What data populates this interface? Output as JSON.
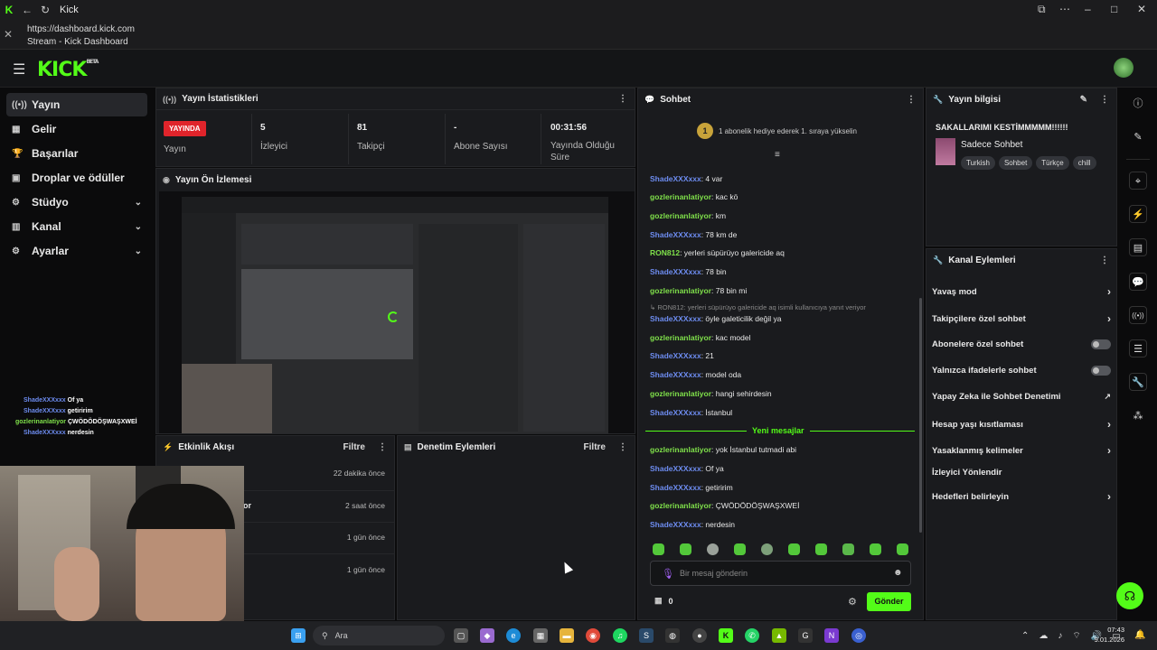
{
  "browser": {
    "tab_title": "Kick",
    "url": "https://dashboard.kick.com",
    "page_title": "Stream - Kick Dashboard"
  },
  "app": {
    "logo": "KICK",
    "logo_sup": "BETA"
  },
  "sidebar": {
    "items": [
      {
        "label": "Yayın",
        "icon": "broadcast-icon"
      },
      {
        "label": "Gelir",
        "icon": "grid-icon"
      },
      {
        "label": "Başarılar",
        "icon": "trophy-icon"
      },
      {
        "label": "Droplar ve ödüller",
        "icon": "gift-icon"
      },
      {
        "label": "Stüdyo",
        "icon": "studio-icon"
      },
      {
        "label": "Kanal",
        "icon": "bar-chart-icon"
      },
      {
        "label": "Ayarlar",
        "icon": "gear-icon"
      }
    ]
  },
  "stats": {
    "title": "Yayın İstatistikleri",
    "live_badge": "YAYINDA",
    "live_label": "Yayın",
    "viewers_value": "5",
    "viewers_label": "İzleyici",
    "followers_value": "81",
    "followers_label": "Takipçi",
    "subs_value": "-",
    "subs_label": "Abone Sayısı",
    "duration_value": "00:31:56",
    "duration_label": "Yayında Olduğu Süre"
  },
  "preview": {
    "title": "Yayın Ön İzlemesi"
  },
  "activity": {
    "title": "Etkinlik Akışı",
    "filter": "Filtre",
    "rows": [
      {
        "text": "",
        "time": "22 dakika önce"
      },
      {
        "text": "or",
        "time": "2 saat önce"
      },
      {
        "text": "",
        "time": "1 gün önce"
      },
      {
        "text": "",
        "time": "1 gün önce"
      }
    ]
  },
  "moderation": {
    "title": "Denetim Eylemleri",
    "filter": "Filtre"
  },
  "chat": {
    "title": "Sohbet",
    "pinned_badge": "1",
    "pinned_text": "1 abonelik hediye ederek 1. sıraya yükselin",
    "messages": [
      {
        "user": "ShadeXXXxxx",
        "color": "b",
        "text": ": 4 var"
      },
      {
        "user": "gozlerinanlatiyor",
        "color": "g",
        "text": ": kac kö"
      },
      {
        "user": "gozlerinanlatiyor",
        "color": "g",
        "text": ": km"
      },
      {
        "user": "ShadeXXXxxx",
        "color": "b",
        "text": ": 78 km de"
      },
      {
        "user": "RON812",
        "color": "g",
        "text": ": yerleri süpürüyo galericide aq"
      },
      {
        "user": "ShadeXXXxxx",
        "color": "b",
        "text": ": 78 bin"
      },
      {
        "user": "gozlerinanlatiyor",
        "color": "g",
        "text": ": 78 bin mi"
      },
      {
        "user": "ShadeXXXxxx",
        "color": "b",
        "text": ": öyle galeticilik değil ya"
      },
      {
        "user": "gozlerinanlatiyor",
        "color": "g",
        "text": ": kac model"
      },
      {
        "user": "ShadeXXXxxx",
        "color": "b",
        "text": ": 21"
      },
      {
        "user": "ShadeXXXxxx",
        "color": "b",
        "text": ": model oda"
      },
      {
        "user": "gozlerinanlatiyor",
        "color": "g",
        "text": ": hangi sehirdesin"
      },
      {
        "user": "ShadeXXXxxx",
        "color": "b",
        "text": ": İstanbul"
      },
      {
        "user": "gozlerinanlatiyor",
        "color": "g",
        "text": ": yok İstanbul tutmadi abi"
      },
      {
        "user": "ShadeXXXxxx",
        "color": "b",
        "text": ": Of ya"
      },
      {
        "user": "ShadeXXXxxx",
        "color": "b",
        "text": ": getiririm"
      },
      {
        "user": "gozlerinanlatiyor",
        "color": "g",
        "text": ": ÇWÖDÖDÖŞWAŞXWEİ"
      },
      {
        "user": "ShadeXXXxxx",
        "color": "b",
        "text": ": nerdesin"
      }
    ],
    "reply_note": "RON812: yerleri süpürüyo galericide aq isimli kullanıcıya yanıt veriyor",
    "new_messages": "Yeni mesajlar",
    "input_placeholder": "Bir mesaj gönderin",
    "points": "0",
    "send": "Gönder"
  },
  "stream_info": {
    "title": "Yayın bilgisi",
    "stream_title": "SAKALLARIMI KESTİMMMMM!!!!!!",
    "category": "Sadece Sohbet",
    "tags": [
      "Turkish",
      "Sohbet",
      "Türkçe",
      "chill"
    ]
  },
  "channel_actions": {
    "title": "Kanal Eylemleri",
    "items": [
      {
        "label": "Yavaş mod",
        "kind": "arrow"
      },
      {
        "label": "Takipçilere özel sohbet",
        "kind": "arrow"
      },
      {
        "label": "Abonelere özel sohbet",
        "kind": "toggle"
      },
      {
        "label": "Yalnızca ifadelerle sohbet",
        "kind": "toggle"
      },
      {
        "label": "Yapay Zeka ile Sohbet Denetimi",
        "kind": "external"
      },
      {
        "label": "Hesap yaşı kısıtlaması",
        "kind": "arrow"
      },
      {
        "label": "Yasaklanmış kelimeler",
        "kind": "arrow"
      },
      {
        "label": "İzleyici Yönlendir",
        "kind": "none"
      },
      {
        "label": "Hedefleri belirleyin",
        "kind": "arrow"
      }
    ]
  },
  "overlay_chat": [
    {
      "user": "ShadeXXXxxx",
      "text": "Of ya"
    },
    {
      "user": "ShadeXXXxxx",
      "text": "getiririm"
    },
    {
      "user": "gozlerinanlatiyor",
      "text": "ÇWÖDÖDÖŞWAŞXWEİ"
    },
    {
      "user": "ShadeXXXxxx",
      "text": "nerdesin"
    }
  ],
  "taskbar": {
    "search": "Ara",
    "time": "07:43",
    "date": "9.01.2026"
  },
  "colors": {
    "accent": "#53fc18",
    "live": "#e0242b",
    "user_green": "#7fe04a",
    "user_blue": "#6d8cf0"
  }
}
